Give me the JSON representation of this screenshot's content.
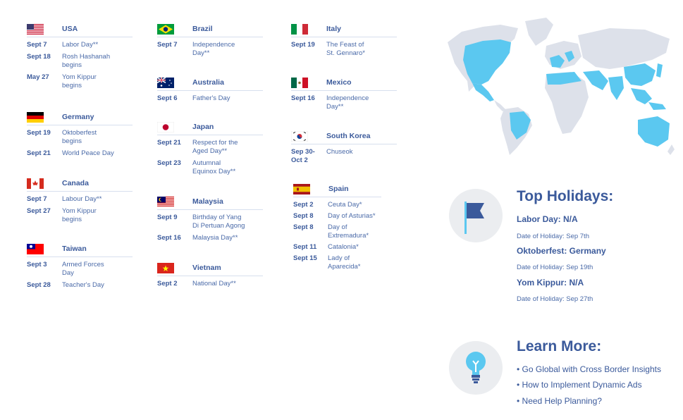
{
  "countries": [
    {
      "name": "USA",
      "flag": "usa-flag",
      "holidays": [
        {
          "date": "Sept 7",
          "name": "Labor Day**"
        },
        {
          "date": "Sept 18",
          "name": "Rosh Hashanah\nbegins"
        },
        {
          "date": "May 27",
          "name": "Yom Kippur\nbegins"
        }
      ]
    },
    {
      "name": "Germany",
      "flag": "germany-flag",
      "holidays": [
        {
          "date": "Sept 19",
          "name": "Oktoberfest\nbegins"
        },
        {
          "date": "Sept 21",
          "name": "World Peace Day"
        }
      ]
    },
    {
      "name": "Canada",
      "flag": "canada-flag",
      "holidays": [
        {
          "date": "Sept 7",
          "name": "Labour Day**"
        },
        {
          "date": "Sept 27",
          "name": "Yom Kippur\nbegins"
        }
      ]
    },
    {
      "name": "Taiwan",
      "flag": "taiwan-flag",
      "holidays": [
        {
          "date": "Sept 3",
          "name": "Armed Forces\nDay"
        },
        {
          "date": "Sept 28",
          "name": "Teacher's Day"
        }
      ]
    },
    {
      "name": "Brazil",
      "flag": "brazil-flag",
      "holidays": [
        {
          "date": "Sept 7",
          "name": "Independence\nDay**"
        }
      ]
    },
    {
      "name": "Australia",
      "flag": "australia-flag",
      "holidays": [
        {
          "date": "Sept 6",
          "name": "Father's Day"
        }
      ]
    },
    {
      "name": "Japan",
      "flag": "japan-flag",
      "holidays": [
        {
          "date": "Sept 21",
          "name": "Respect for the\nAged Day**"
        },
        {
          "date": "Sept 23",
          "name": "Autumnal\nEquinox Day**"
        }
      ]
    },
    {
      "name": "Malaysia",
      "flag": "malaysia-flag",
      "holidays": [
        {
          "date": "Sept 9",
          "name": "Birthday of Yang\nDi Pertuan Agong"
        },
        {
          "date": "Sept 16",
          "name": "Malaysia Day**"
        }
      ]
    },
    {
      "name": "Vietnam",
      "flag": "vietnam-flag",
      "holidays": [
        {
          "date": "Sept 2",
          "name": "National Day**"
        }
      ]
    },
    {
      "name": "Italy",
      "flag": "italy-flag",
      "holidays": [
        {
          "date": "Sept 19",
          "name": "The Feast of\nSt. Gennaro*"
        }
      ]
    },
    {
      "name": "Mexico",
      "flag": "mexico-flag",
      "holidays": [
        {
          "date": "Sept 16",
          "name": "Independence\nDay**"
        }
      ]
    },
    {
      "name": "South Korea",
      "flag": "south-korea-flag",
      "holidays": [
        {
          "date": "Sep 30-\nOct 2",
          "name": "Chuseok"
        }
      ]
    },
    {
      "name": "Spain",
      "flag": "spain-flag",
      "holidays": [
        {
          "date": "Sept 2",
          "name": "Ceuta Day*"
        },
        {
          "date": "Sept 8",
          "name": "Day of Asturias*"
        },
        {
          "date": "Sept 8",
          "name": "Day of\nExtremadura*"
        },
        {
          "date": "Sept 11",
          "name": "Catalonia*"
        },
        {
          "date": "Sept 15",
          "name": "Lady of Aparecida*"
        }
      ]
    }
  ],
  "top": {
    "heading": "Top Holidays:",
    "items": [
      {
        "title": "Labor Day: N/A",
        "date": "Date of Holiday: Sep 7th"
      },
      {
        "title": "Oktoberfest: Germany",
        "date": "Date of Holiday: Sep 19th"
      },
      {
        "title": "Yom Kippur: N/A",
        "date": "Date of Holiday: Sep 27th"
      }
    ]
  },
  "learn": {
    "heading": "Learn More:",
    "links": [
      "• Go Global with Cross Border Insights",
      "• How to Implement Dynamic Ads",
      "• Need Help Planning?"
    ]
  },
  "icons": {
    "flag": "flag-icon",
    "bulb": "lightbulb-icon",
    "map": "world-map"
  },
  "colors": {
    "text": "#3b5a9b",
    "accent": "#5bc8f0",
    "map_land": "#dde1ea",
    "rule": "#d7dfee"
  }
}
